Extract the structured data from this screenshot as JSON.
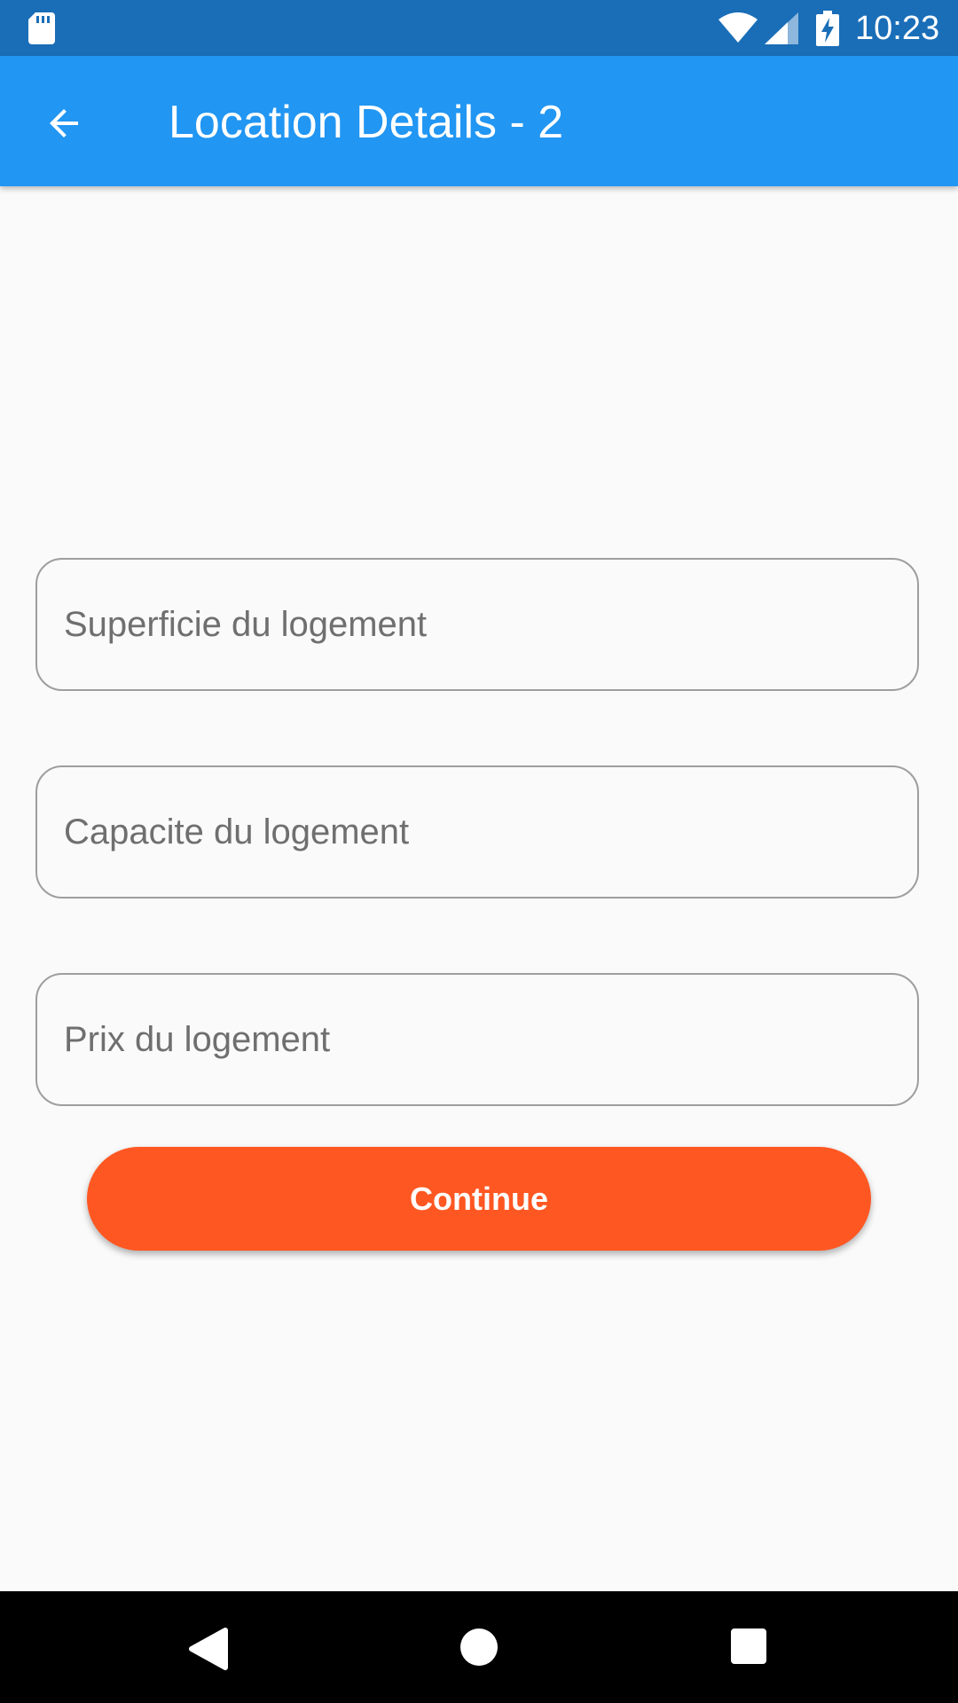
{
  "status_bar": {
    "time": "10:23",
    "icons": [
      "sd-card-icon",
      "wifi-icon",
      "cell-signal-icon",
      "battery-charging-icon"
    ],
    "color": "#1a6eb8"
  },
  "app_bar": {
    "title": "Location Details - 2",
    "back_icon": "arrow-back-icon",
    "color": "#2196f3"
  },
  "form": {
    "fields": [
      {
        "value": "",
        "placeholder": "Superficie du logement"
      },
      {
        "value": "",
        "placeholder": "Capacite du logement"
      },
      {
        "value": "",
        "placeholder": "Prix du logement"
      }
    ],
    "continue_label": "Continue",
    "continue_color": "#ff5722"
  },
  "nav_bar": {
    "icons": [
      "nav-back-icon",
      "nav-home-icon",
      "nav-recents-icon"
    ]
  }
}
